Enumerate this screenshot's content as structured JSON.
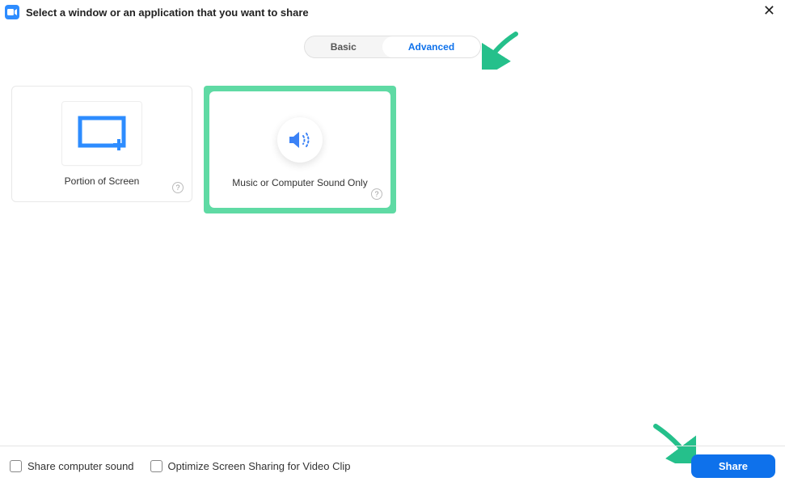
{
  "header": {
    "title": "Select a window or an application that you want to share"
  },
  "tabs": {
    "basic": "Basic",
    "advanced": "Advanced"
  },
  "cards": {
    "portion": {
      "label": "Portion of Screen"
    },
    "sound": {
      "label": "Music or Computer Sound Only"
    }
  },
  "footer": {
    "shareSound": "Share computer sound",
    "optimizeVideo": "Optimize Screen Sharing for Video Clip",
    "shareButton": "Share"
  }
}
